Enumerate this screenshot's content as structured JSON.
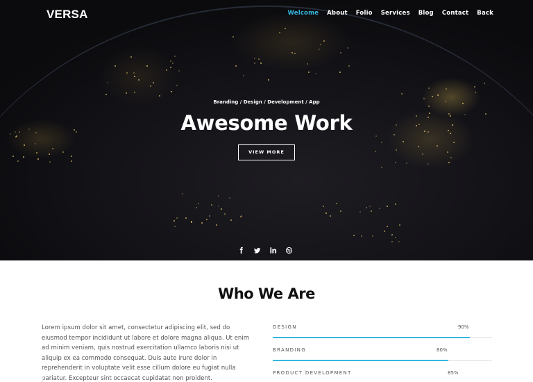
{
  "brand": "VERSA",
  "nav": {
    "items": [
      {
        "label": "Welcome",
        "active": true
      },
      {
        "label": "About"
      },
      {
        "label": "Folio"
      },
      {
        "label": "Services"
      },
      {
        "label": "Blog"
      },
      {
        "label": "Contact"
      },
      {
        "label": "Back"
      }
    ],
    "active_color": "#35b7e0"
  },
  "hero": {
    "subtitle": "Branding / Design / Development / App",
    "title": "Awesome Work",
    "button_label": "VIEW MORE",
    "social_icons": [
      "facebook-icon",
      "twitter-icon",
      "linkedin-icon",
      "dribbble-icon"
    ]
  },
  "about": {
    "title": "Who We Are",
    "paragraph": "Lorem ipsum dolor sit amet, consectetur adipiscing elit, sed do eiusmod tempor incididunt ut labore et dolore magna aliqua. Ut enim ad minim veniam, quis nostrud exercitation ullamco laboris nisi ut aliquip ex ea commodo consequat. Duis aute irure dolor in reprehenderit in voluptate velit esse cillum dolore eu fugiat nulla pariatur. Excepteur sint occaecat cupidatat non proident.",
    "skills": [
      {
        "name": "DESIGN",
        "percent_label": "90%",
        "value": 90
      },
      {
        "name": "BRANDING",
        "percent_label": "80%",
        "value": 80
      },
      {
        "name": "PRODUCT DEVELOPMENT",
        "percent_label": "85%",
        "value": 85
      }
    ],
    "bar_color": "#35b7e0"
  }
}
